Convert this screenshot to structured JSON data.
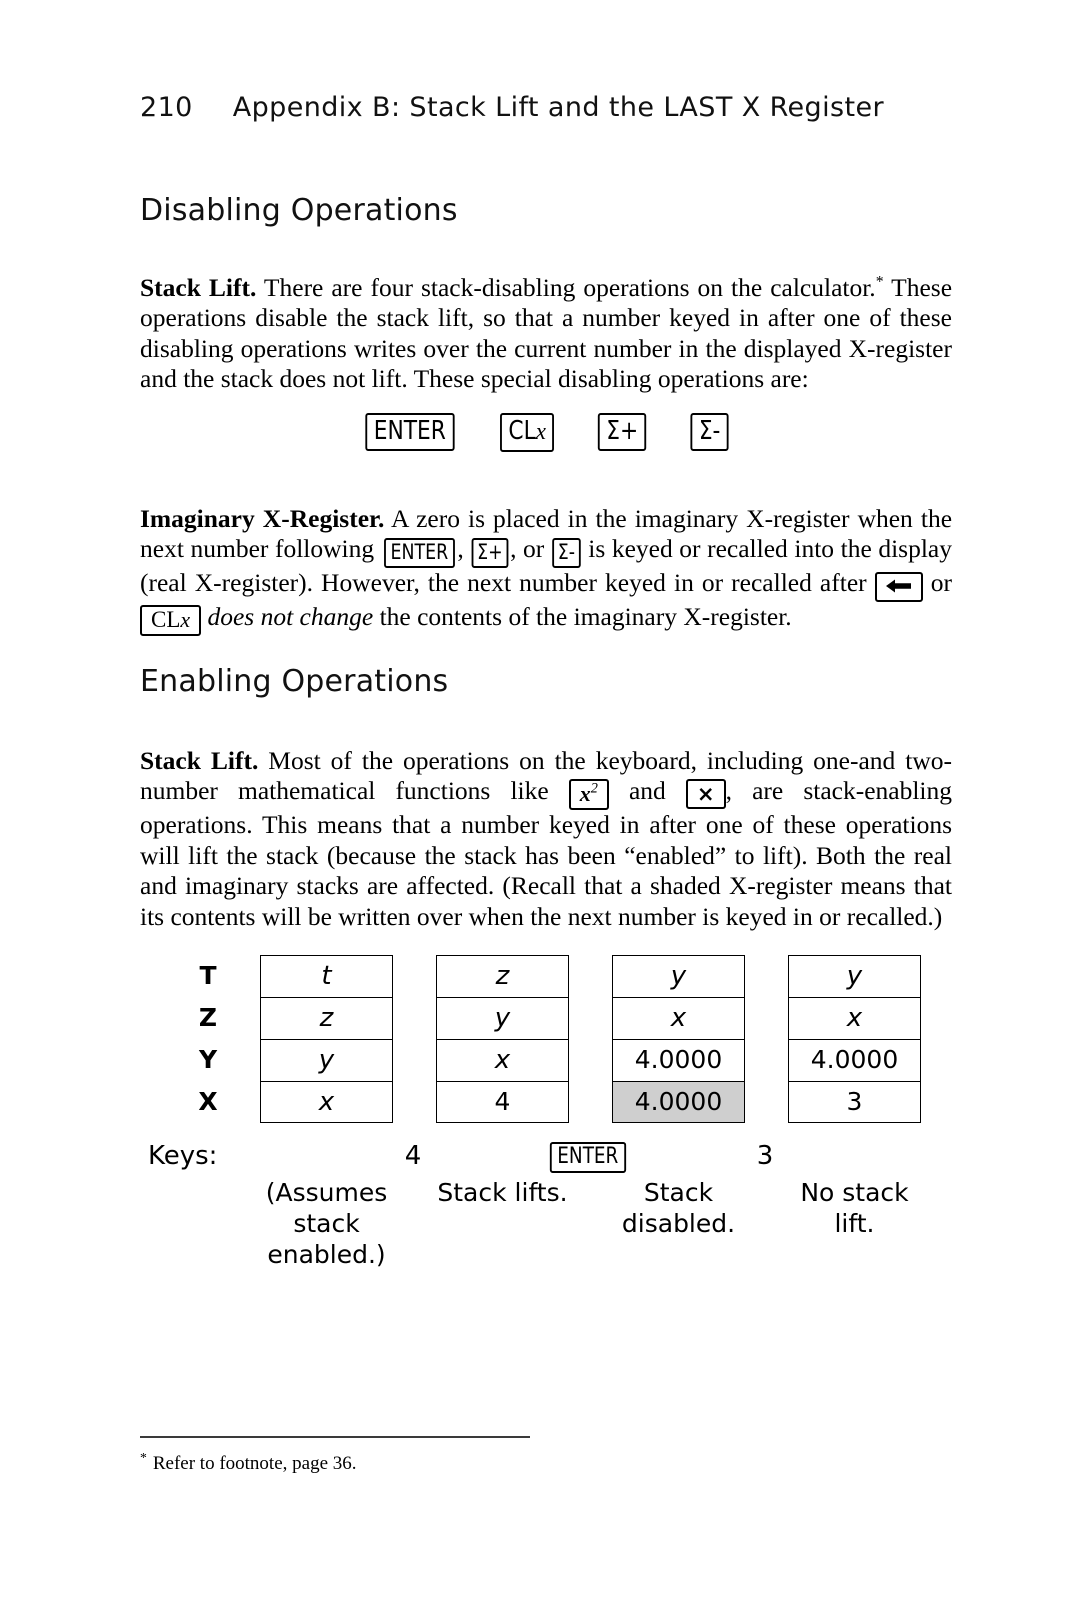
{
  "page": {
    "folio": "210",
    "running_head": "Appendix B: Stack Lift and the LAST X Register"
  },
  "sections": {
    "disabling": {
      "heading": "Disabling Operations",
      "stack_lift": {
        "lead": "Stack Lift.",
        "body": "There are four stack-disabling operations on the calculator.",
        "footnote_mark": "*",
        "body_cont": "These operations disable the stack lift, so that a number keyed in after one of these disabling operations writes over the current number in the displayed X-register and the stack does not lift. These special disabling operations are:"
      },
      "key_row": [
        {
          "label": "ENTER",
          "name": "enter-key"
        },
        {
          "label": "CLx",
          "name": "clx-key"
        },
        {
          "label": "Σ+",
          "name": "sigma-plus-key"
        },
        {
          "label": "Σ-",
          "name": "sigma-minus-key"
        }
      ],
      "imaginary": {
        "lead": "Imaginary X-Register.",
        "t1": "A zero is placed in the imaginary X-register when the next number following",
        "k1": "ENTER",
        "t2": ",",
        "k2": "Σ+",
        "t3": ", or",
        "k3": "Σ-",
        "t4": "is keyed or recalled into the display (real X-register). However, the next number keyed in or recalled after",
        "k4": "←",
        "t5": "or",
        "k5": "CLx",
        "t6_italic": "does not change",
        "t7": "the contents of the imaginary X-register."
      }
    },
    "enabling": {
      "heading": "Enabling Operations",
      "stack_lift": {
        "lead": "Stack Lift.",
        "t1": "Most of the operations on the keyboard, including one-and two-number mathematical functions like",
        "k1": "x2",
        "t2": "and",
        "k2": "×",
        "t3": ", are stack-enabling operations. This means that a number keyed in after one of these operations will lift the stack (because the stack has been “enabled” to lift). Both the real and imaginary stacks are affected. (Recall that a shaded X-register means that its contents will be written over when the next number is keyed in or recalled.)"
      }
    }
  },
  "stack_diagram": {
    "register_labels": [
      "T",
      "Z",
      "Y",
      "X"
    ],
    "columns": [
      {
        "cells": [
          {
            "value": "t",
            "style": "var",
            "shaded": false
          },
          {
            "value": "z",
            "style": "var",
            "shaded": false
          },
          {
            "value": "y",
            "style": "var",
            "shaded": false
          },
          {
            "value": "x",
            "style": "var",
            "shaded": false
          }
        ],
        "caption": "(Assumes stack enabled.)"
      },
      {
        "cells": [
          {
            "value": "z",
            "style": "var",
            "shaded": false
          },
          {
            "value": "y",
            "style": "var",
            "shaded": false
          },
          {
            "value": "x",
            "style": "var",
            "shaded": false
          },
          {
            "value": "4",
            "style": "num",
            "shaded": false
          }
        ],
        "caption": "Stack lifts."
      },
      {
        "cells": [
          {
            "value": "y",
            "style": "var",
            "shaded": false
          },
          {
            "value": "x",
            "style": "var",
            "shaded": false
          },
          {
            "value": "4.0000",
            "style": "num",
            "shaded": false
          },
          {
            "value": "4.0000",
            "style": "num",
            "shaded": true
          }
        ],
        "caption": "Stack disabled."
      },
      {
        "cells": [
          {
            "value": "y",
            "style": "var",
            "shaded": false
          },
          {
            "value": "x",
            "style": "var",
            "shaded": false
          },
          {
            "value": "4.0000",
            "style": "num",
            "shaded": false
          },
          {
            "value": "3",
            "style": "num",
            "shaded": false
          }
        ],
        "caption": "No stack lift."
      }
    ],
    "keys_label": "Keys:",
    "keystrokes": [
      {
        "label": "4",
        "is_key": false
      },
      {
        "label": "ENTER",
        "is_key": true
      },
      {
        "label": "3",
        "is_key": false
      }
    ],
    "shade_color": "#cfcfcf"
  },
  "footnote": {
    "mark": "*",
    "text": "Refer to footnote, page 36."
  }
}
